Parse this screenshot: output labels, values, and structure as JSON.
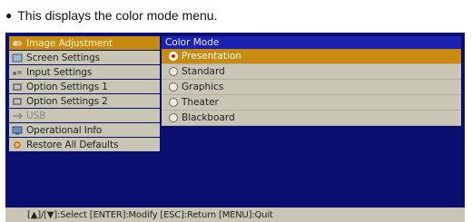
{
  "caption": {
    "bullet": "●",
    "text": "This displays the color mode menu."
  },
  "sidebar": {
    "items": [
      {
        "label": "Image Adjustment",
        "icon": "image-adjustment-icon",
        "state": "selected"
      },
      {
        "label": "Screen Settings",
        "icon": "screen-settings-icon",
        "state": "normal"
      },
      {
        "label": "Input Settings",
        "icon": "input-settings-icon",
        "state": "normal"
      },
      {
        "label": "Option Settings 1",
        "icon": "option-settings-1-icon",
        "state": "normal"
      },
      {
        "label": "Option Settings 2",
        "icon": "option-settings-2-icon",
        "state": "normal"
      },
      {
        "label": "USB",
        "icon": "usb-icon",
        "state": "disabled"
      },
      {
        "label": "Operational Info",
        "icon": "operational-info-icon",
        "state": "normal"
      },
      {
        "label": "Restore All Defaults",
        "icon": "restore-defaults-icon",
        "state": "normal"
      }
    ]
  },
  "color_mode": {
    "title": "Color Mode",
    "options": [
      {
        "label": "Presentation",
        "selected": true
      },
      {
        "label": "Standard",
        "selected": false
      },
      {
        "label": "Graphics",
        "selected": false
      },
      {
        "label": "Theater",
        "selected": false
      },
      {
        "label": "Blackboard",
        "selected": false
      }
    ]
  },
  "status_bar": {
    "text": "[▲]/[▼]:Select [ENTER]:Modify [ESC]:Return [MENU]:Quit"
  },
  "colors": {
    "background": "#0a0e6e",
    "item": "#c9c6b6",
    "selected": "#c98a10",
    "panel_header": "#1b21b0"
  }
}
